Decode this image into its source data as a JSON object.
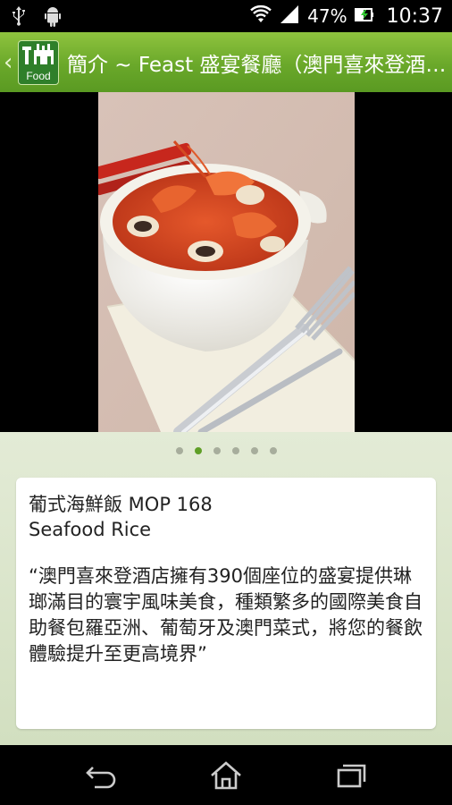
{
  "status_bar": {
    "battery_percent": "47%",
    "time": "10:37",
    "icons": [
      "usb-icon",
      "android-icon",
      "wifi-icon",
      "signal-icon",
      "battery-charging-icon"
    ]
  },
  "action_bar": {
    "title": "簡介 ~ Feast 盛宴餐廳（澳門喜來登酒店）",
    "logo_text": "Food",
    "back_icon": "chevron-left-icon"
  },
  "gallery": {
    "total_pages": 6,
    "current_page": 2,
    "image_alt": "Seafood rice dish photo"
  },
  "card": {
    "title_line1": "葡式海鮮飯 MOP 168",
    "title_line2": "Seafood Rice",
    "description": "“澳門喜來登酒店擁有390個座位的盛宴提供琳瑯滿目的寰宇風味美食，種類繁多的國際美食自助餐包羅亞洲、葡萄牙及澳門菜式，將您的餐飲體驗提升至更高境界”"
  },
  "nav_bar": {
    "icons": [
      "back-icon",
      "home-icon",
      "recents-icon"
    ]
  },
  "colors": {
    "accent_green": "#6aa82a",
    "active_dot": "#5f9f27",
    "content_bg": "#dde6cf"
  }
}
